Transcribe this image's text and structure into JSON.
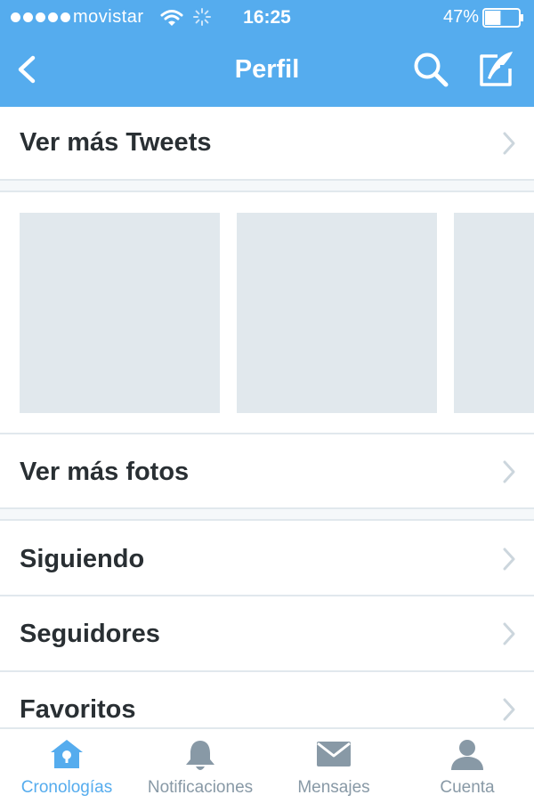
{
  "status_bar": {
    "carrier": "movistar",
    "time": "16:25",
    "battery_percent": "47%",
    "battery_level": 0.47
  },
  "nav": {
    "title": "Perfil",
    "back_icon": "chevron-left-icon",
    "search_icon": "search-icon",
    "compose_icon": "compose-icon"
  },
  "sections": {
    "more_tweets": "Ver más Tweets",
    "more_photos": "Ver más fotos",
    "following": "Siguiendo",
    "followers": "Seguidores",
    "favorites": "Favoritos"
  },
  "tabs": [
    {
      "label": "Cronologías",
      "icon": "home-icon",
      "active": true
    },
    {
      "label": "Notificaciones",
      "icon": "bell-icon",
      "active": false
    },
    {
      "label": "Mensajes",
      "icon": "envelope-icon",
      "active": false
    },
    {
      "label": "Cuenta",
      "icon": "person-icon",
      "active": false
    }
  ],
  "colors": {
    "brand": "#55acee",
    "placeholder": "#e1e8ed",
    "text": "#292f33",
    "inactive_tab": "#8899a6"
  }
}
